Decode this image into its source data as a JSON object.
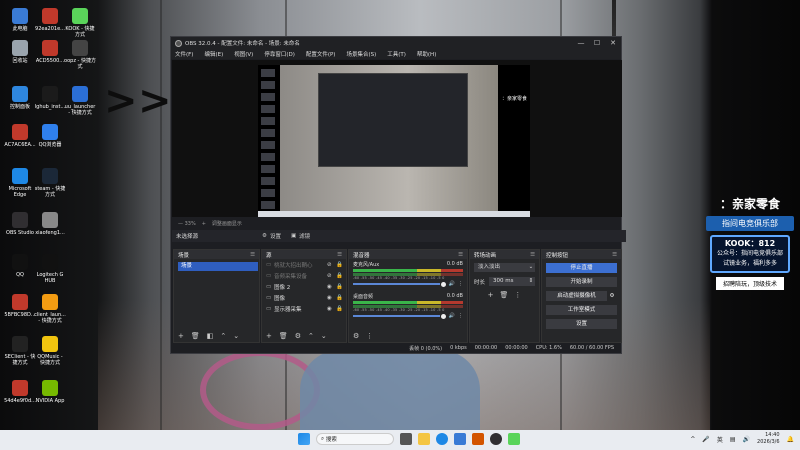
{
  "desktop": {
    "icons": [
      {
        "label": "此电脑",
        "color": "#3a7bd5"
      },
      {
        "label": "92ea201e...",
        "color": "#c0392b"
      },
      {
        "label": "KOOK - 快捷方式",
        "color": "#5ad45a"
      },
      {
        "label": "回收站",
        "color": "#9aa4ad"
      },
      {
        "label": "ACD5500...",
        "color": "#c0392b"
      },
      {
        "label": "oopz - 快捷方式",
        "color": "#444"
      },
      {
        "label": "控制面板",
        "color": "#2e86de"
      },
      {
        "label": "lghub_inst...",
        "color": "#1b1b1b"
      },
      {
        "label": "uu_launcher - 快捷方式",
        "color": "#2b6fd6"
      },
      {
        "label": "AC7AC6EA...",
        "color": "#c0392b"
      },
      {
        "label": "QQ浏览器",
        "color": "#2f80ed"
      },
      {
        "label": "Microsoft Edge",
        "color": "#1e88e5"
      },
      {
        "label": "steam - 快捷方式",
        "color": "#1b2838"
      },
      {
        "label": "OBS Studio",
        "color": "#302e31"
      },
      {
        "label": "xiaofeng1...",
        "color": "#888"
      },
      {
        "label": "QQ",
        "color": "#111"
      },
      {
        "label": "Logitech G HUB",
        "color": "#111"
      },
      {
        "label": "5BFBC98D...",
        "color": "#c0392b"
      },
      {
        "label": "client_laun... - 快捷方式",
        "color": "#f39c12"
      },
      {
        "label": "SEClient - 快捷方式",
        "color": "#222"
      },
      {
        "label": "QQMusic - 快捷方式",
        "color": "#f1c40f"
      },
      {
        "label": "54d4e9f0d...",
        "color": "#c0392b"
      },
      {
        "label": "NVIDIA App",
        "color": "#76b900"
      }
    ]
  },
  "right_panel": {
    "title": "：亲家零食",
    "sub": "指间电竞俱乐部",
    "kook": "KOOK：812",
    "line1": "公众号：指间电竞俱乐部",
    "line2": "试镜业务，福利多多",
    "foot": "招聘陪玩，顶级技术"
  },
  "obs": {
    "title": "OBS 32.0.4 - 配置文件: 未命名 - 场景: 未命名",
    "window_buttons": {
      "minimize": "—",
      "maximize": "☐",
      "close": "✕"
    },
    "menu": [
      "文件(F)",
      "编辑(E)",
      "视图(V)",
      "停靠窗口(D)",
      "配置文件(P)",
      "场景集合(S)",
      "工具(T)",
      "帮助(H)"
    ],
    "zoom": [
      "— 33%",
      "+",
      "调整画面显示"
    ],
    "source_bar": {
      "label": "未选择源",
      "properties": "设置",
      "filters": "滤镜"
    },
    "scenes": {
      "header": "场景",
      "items": [
        "场景"
      ]
    },
    "sources": {
      "header": "源",
      "items": [
        {
          "name": "桃就大招出鞘心",
          "hidden": true
        },
        {
          "name": "音频采集设备",
          "hidden": true
        },
        {
          "name": "图像 2",
          "hidden": false
        },
        {
          "name": "图像",
          "hidden": false
        },
        {
          "name": "显示器采集",
          "hidden": false
        }
      ]
    },
    "mixer": {
      "header": "混音器",
      "channels": [
        {
          "name": "麦克风/Aux",
          "db": "0.0 dB"
        },
        {
          "name": "桌面音频",
          "db": "0.0 dB"
        }
      ],
      "scale": "-60 -55 -50 -45 -40 -35 -30 -25 -20 -15 -10 -5 0"
    },
    "transitions": {
      "header": "转场动画",
      "selected": "淡入淡出",
      "duration_label": "时长",
      "duration_value": "300 ms"
    },
    "controls": {
      "header": "控制按钮",
      "stop_stream": "停止直播",
      "start_record": "开始录制",
      "virtual_cam": "启动虚拟摄像机",
      "studio_mode": "工作室模式",
      "settings": "设置"
    },
    "status": {
      "dropped": "丢帧 0 (0.0%)",
      "bitrate": "0 kbps",
      "rec_time": "00:00:00",
      "stream_time": "00:00:00",
      "cpu": "CPU: 1.6%",
      "fps": "60.00 / 60.00 FPS"
    }
  },
  "taskbar": {
    "search_placeholder": "搜索",
    "lang": "英",
    "time": "14:40",
    "date": "2026/3/6"
  },
  "canvas_side": {
    "l1": "：亲家零食"
  }
}
